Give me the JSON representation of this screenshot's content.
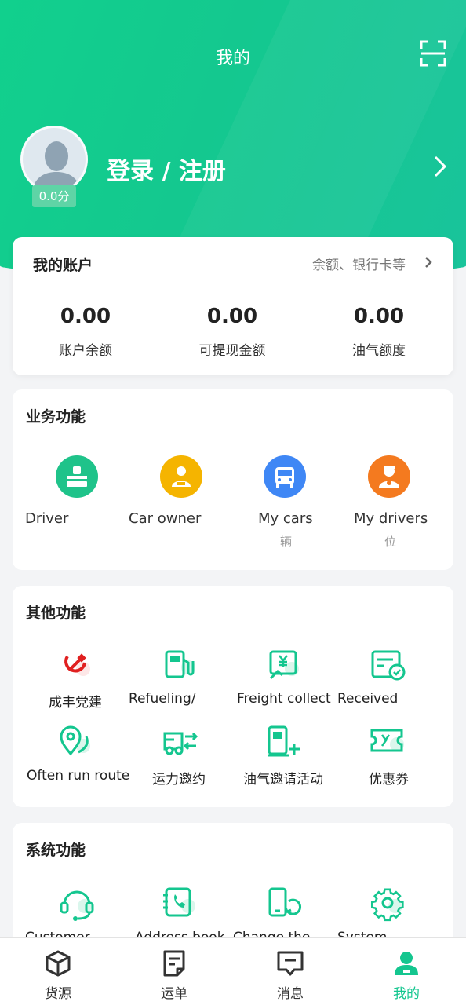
{
  "header": {
    "title": "我的",
    "scan_icon": "scan-icon"
  },
  "profile": {
    "score": "0.0分",
    "login_label": "登录 / 注册",
    "avatar_icon": "avatar-placeholder"
  },
  "account": {
    "title": "我的账户",
    "more_label": "余额、银行卡等",
    "stats": [
      {
        "value": "0.00",
        "label": "账户余额"
      },
      {
        "value": "0.00",
        "label": "可提现金额"
      },
      {
        "value": "0.00",
        "label": "油气额度"
      }
    ]
  },
  "business": {
    "title": "业务功能",
    "items": [
      {
        "label": "Driver",
        "icon": "driver-icon",
        "color": "#1fc38a"
      },
      {
        "label": "Car owner",
        "icon": "car-owner-icon",
        "color": "#f5b400"
      },
      {
        "label": "My cars",
        "sub": "辆",
        "icon": "car-icon",
        "color": "#3f87f5"
      },
      {
        "label": "My drivers",
        "sub": "位",
        "icon": "drivers-icon",
        "color": "#f47a1f"
      }
    ]
  },
  "other": {
    "title": "其他功能",
    "items": [
      {
        "label": "成丰党建",
        "icon": "party-emblem-icon"
      },
      {
        "label": "Refueling/",
        "icon": "fuel-pump-icon"
      },
      {
        "label": "Freight collect",
        "icon": "freight-receipt-icon"
      },
      {
        "label": "Received",
        "icon": "received-icon"
      },
      {
        "label": "Often run route",
        "icon": "route-icon"
      },
      {
        "label": "运力邀约",
        "icon": "truck-invite-icon"
      },
      {
        "label": "油气邀请活动",
        "icon": "fuel-invite-icon"
      },
      {
        "label": "优惠券",
        "icon": "coupon-icon"
      }
    ]
  },
  "system": {
    "title": "系统功能",
    "items": [
      {
        "label": "Customer",
        "icon": "headset-icon"
      },
      {
        "label": "Address book",
        "icon": "address-book-icon"
      },
      {
        "label": "Change the",
        "icon": "change-phone-icon"
      },
      {
        "label": "System",
        "icon": "settings-gear-icon"
      }
    ]
  },
  "tabbar": {
    "tabs": [
      {
        "label": "货源",
        "icon": "box-icon"
      },
      {
        "label": "运单",
        "icon": "waybill-icon"
      },
      {
        "label": "消息",
        "icon": "message-icon"
      },
      {
        "label": "我的",
        "icon": "user-icon",
        "active": true
      }
    ]
  },
  "colors": {
    "accent": "#14c68f",
    "text": "#222222"
  }
}
